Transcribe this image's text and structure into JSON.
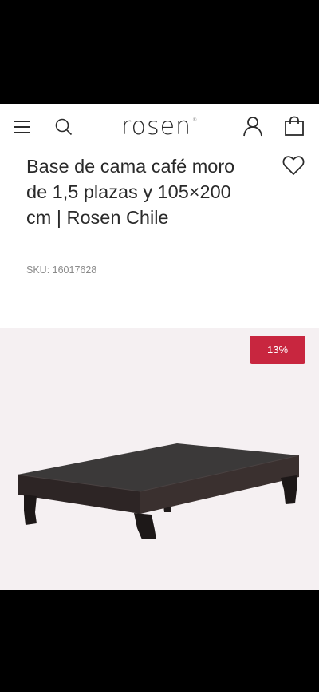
{
  "header": {
    "logo_text": "rosen",
    "logo_mark": "®",
    "icons": [
      "menu-icon",
      "search-icon",
      "user-icon",
      "shopping-bag-icon"
    ]
  },
  "product": {
    "title": "Base de cama café moro de 1,5 plazas y 105×200 cm | Rosen Chile",
    "sku": "SKU: 16017628",
    "discount_badge": "13%",
    "wishlist_icon": "heart-icon"
  },
  "colors": {
    "badge": "#c8263f",
    "image_background": "#f5f0f2",
    "text": "#2a2a2a"
  }
}
